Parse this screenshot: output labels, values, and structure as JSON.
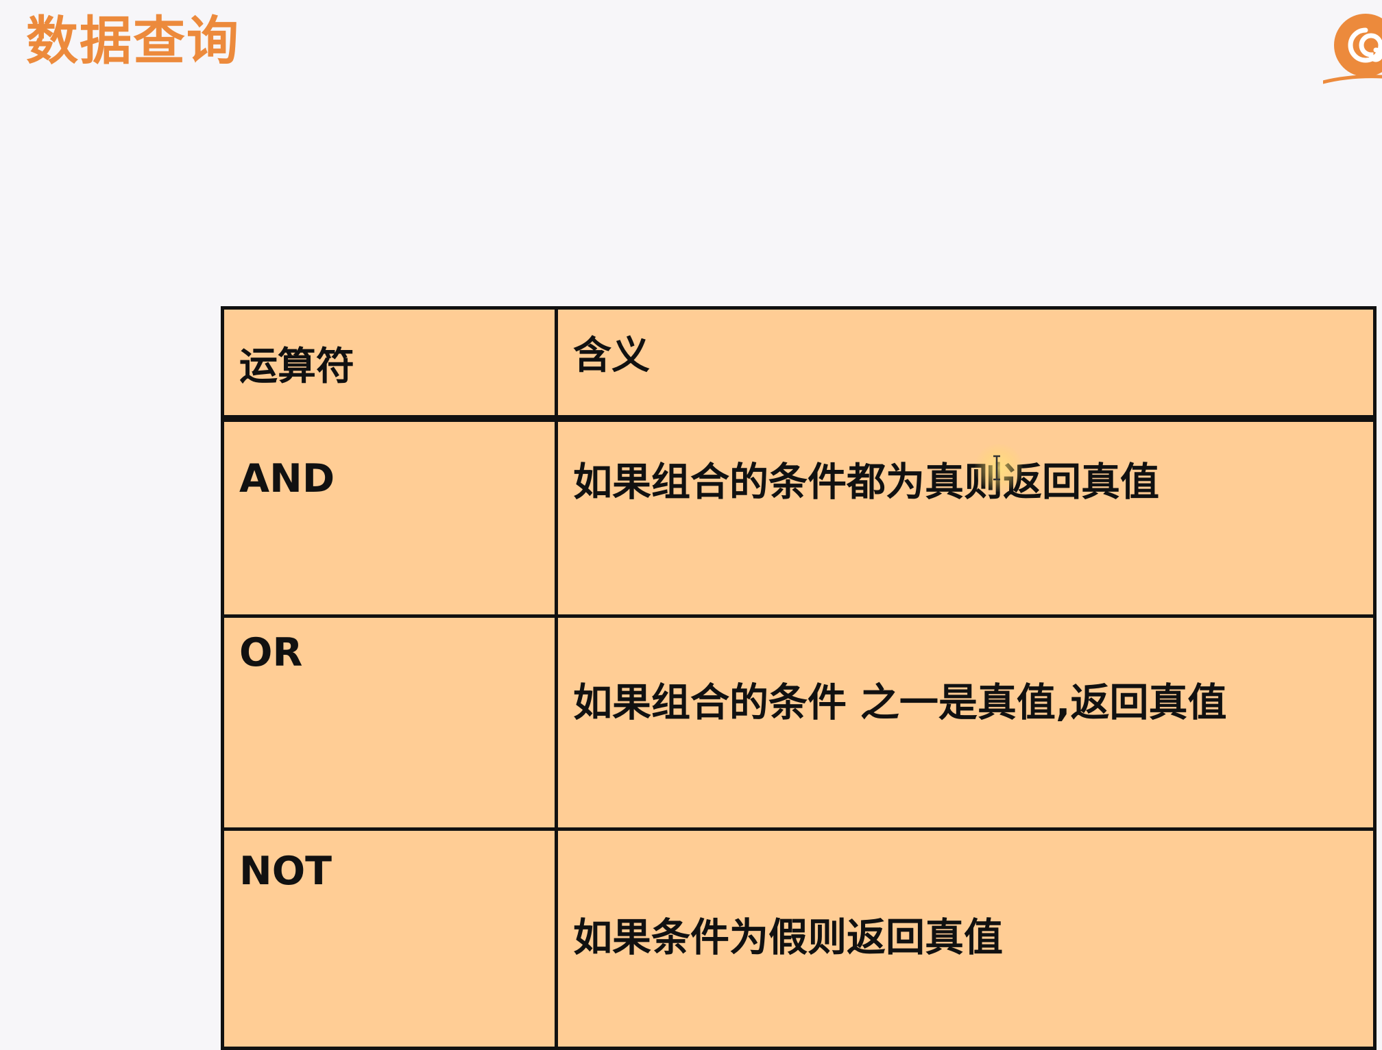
{
  "slide": {
    "title": "数据查询"
  },
  "table": {
    "headers": {
      "operator": "运算符",
      "meaning": "含义"
    },
    "rows": [
      {
        "operator": "AND",
        "meaning": "如果组合的条件都为真则返回真值"
      },
      {
        "operator": "OR",
        "meaning": "如果组合的条件 之一是真值,返回真值"
      },
      {
        "operator": "NOT",
        "meaning": "如果条件为假则返回真值"
      }
    ]
  },
  "colors": {
    "title": "#ec8a3c",
    "table_fill": "#ffcd95",
    "border": "#111111",
    "logo": "#ec8a3c",
    "background": "#f7f6f9"
  },
  "icons": {
    "logo": "snail-logo-icon",
    "cursor": "text-cursor-icon"
  }
}
